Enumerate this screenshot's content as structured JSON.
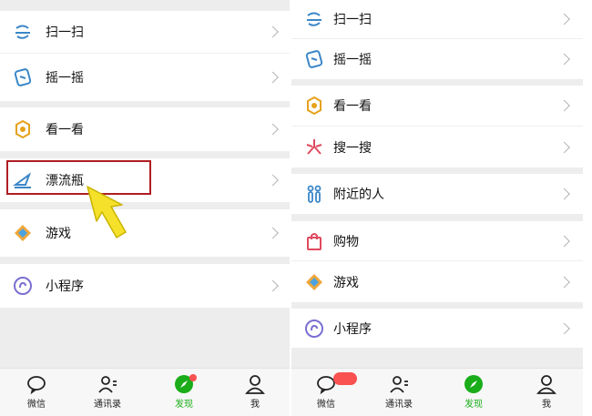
{
  "left_panel": {
    "items": [
      {
        "label": "扫一扫",
        "icon": "scan-icon"
      },
      {
        "label": "摇一摇",
        "icon": "shake-icon"
      },
      {
        "label": "看一看",
        "icon": "top-stories-icon"
      },
      {
        "label": "漂流瓶",
        "icon": "drift-bottle-icon"
      },
      {
        "label": "游戏",
        "icon": "games-icon"
      },
      {
        "label": "小程序",
        "icon": "mini-programs-icon"
      }
    ],
    "tabs": [
      {
        "label": "微信",
        "icon": "chats-icon"
      },
      {
        "label": "通讯录",
        "icon": "contacts-icon"
      },
      {
        "label": "发现",
        "icon": "discover-icon"
      },
      {
        "label": "我",
        "icon": "me-icon"
      }
    ]
  },
  "right_panel": {
    "items": [
      {
        "label": "扫一扫",
        "icon": "scan-icon"
      },
      {
        "label": "摇一摇",
        "icon": "shake-icon"
      },
      {
        "label": "看一看",
        "icon": "top-stories-icon"
      },
      {
        "label": "搜一搜",
        "icon": "search-icon"
      },
      {
        "label": "附近的人",
        "icon": "people-nearby-icon"
      },
      {
        "label": "购物",
        "icon": "shopping-icon"
      },
      {
        "label": "游戏",
        "icon": "games-icon"
      },
      {
        "label": "小程序",
        "icon": "mini-programs-icon"
      }
    ],
    "tabs": [
      {
        "label": "微信",
        "icon": "chats-icon"
      },
      {
        "label": "通讯录",
        "icon": "contacts-icon"
      },
      {
        "label": "发现",
        "icon": "discover-icon"
      },
      {
        "label": "我",
        "icon": "me-icon"
      }
    ]
  },
  "colors": {
    "active_tab": "#1aad19",
    "highlight_box": "#b01d23",
    "arrow": "#f5e12a",
    "badge": "#fa5151"
  }
}
